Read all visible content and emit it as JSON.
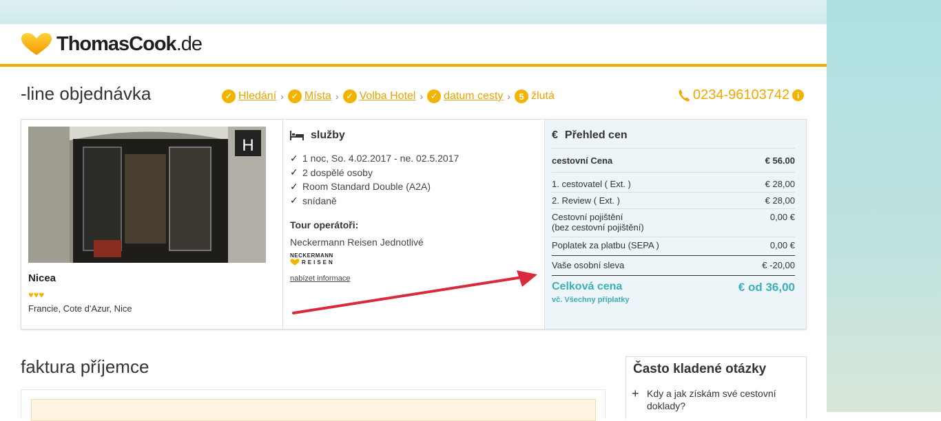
{
  "brand": {
    "name": "ThomasCook",
    "tld": ".de"
  },
  "page": {
    "title": "-line objednávka"
  },
  "steps": [
    {
      "label": "Hledání",
      "done": true
    },
    {
      "label": "Místa",
      "done": true
    },
    {
      "label": "Volba Hotel",
      "done": true
    },
    {
      "label": "datum cesty",
      "done": true
    },
    {
      "label": "žlutá",
      "number": "5",
      "done": false
    }
  ],
  "phone": {
    "number": "0234-96103742",
    "info": "i"
  },
  "hotel": {
    "name": "Nicea",
    "stars": "♥♥♥",
    "location": "Francie, Cote d'Azur, Nice"
  },
  "services": {
    "title": "služby",
    "items": [
      "1 noc, So. 4.02.2017 - ne. 02.5.2017",
      "2 dospělé osoby",
      "Room Standard Double (A2A)",
      "snídaně"
    ],
    "operators_title": "Tour operátoři:",
    "operator_name": "Neckermann Reisen Jednotlivé",
    "operator_logo_text_1": "NECKERMANN",
    "operator_logo_text_2": "REISEN",
    "more_link": "nabízet informace"
  },
  "prices": {
    "title": "Přehled cen",
    "currency_symbol": "€",
    "travel_price_label": "cestovní Cena",
    "travel_price_value": "€ 56.00",
    "rows": [
      {
        "label": "1. cestovatel ( Ext. )",
        "value": "€ 28,00"
      },
      {
        "label": "2. Review ( Ext. )",
        "value": "€ 28,00"
      }
    ],
    "insurance_label_1": "Cestovní pojištění",
    "insurance_label_2": "(bez cestovní pojištění)",
    "insurance_value": "0,00 €",
    "fee_label": "Poplatek za platbu (SEPA )",
    "fee_value": "0,00 €",
    "discount_label": "Vaše osobní sleva",
    "discount_value": "€ -20,00",
    "total_label": "Celková cena",
    "total_value": "€ od 36,00",
    "total_sub": "vč. Všechny příplatky"
  },
  "recipient": {
    "title": "faktura příjemce"
  },
  "faq": {
    "title": "Často kladené otázky",
    "items": [
      "Kdy a jak získám své cestovní doklady?"
    ]
  },
  "colors": {
    "accent": "#f2b400",
    "total": "#3ab0b8",
    "arrow": "#d92a3c",
    "price_bg": "#edf5f8"
  }
}
